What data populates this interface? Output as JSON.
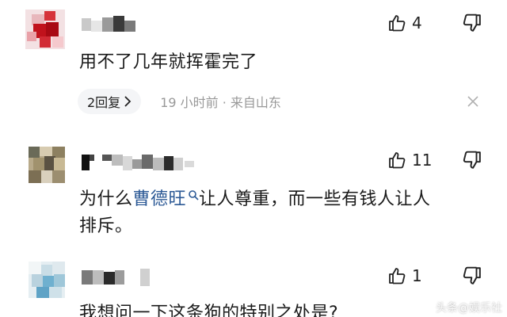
{
  "comments": [
    {
      "likes": "4",
      "text": "用不了几年就挥霍完了",
      "reply_label": "2回复",
      "meta": "19 小时前 · 来自山东"
    },
    {
      "likes": "11",
      "text_before": "为什么",
      "mention": "曹德旺",
      "text_after": "让人尊重，而一些有钱人让人",
      "text_line2": "排斥。"
    },
    {
      "likes": "1",
      "text": "我想问一下这条狗的特别之处是?"
    }
  ],
  "watermark": "头条@娱乐社",
  "icons": {
    "like": "thumbs-up-icon",
    "dislike": "thumbs-down-icon",
    "chevron": "chevron-right-icon",
    "close": "close-icon",
    "mention_search": "search-icon"
  }
}
